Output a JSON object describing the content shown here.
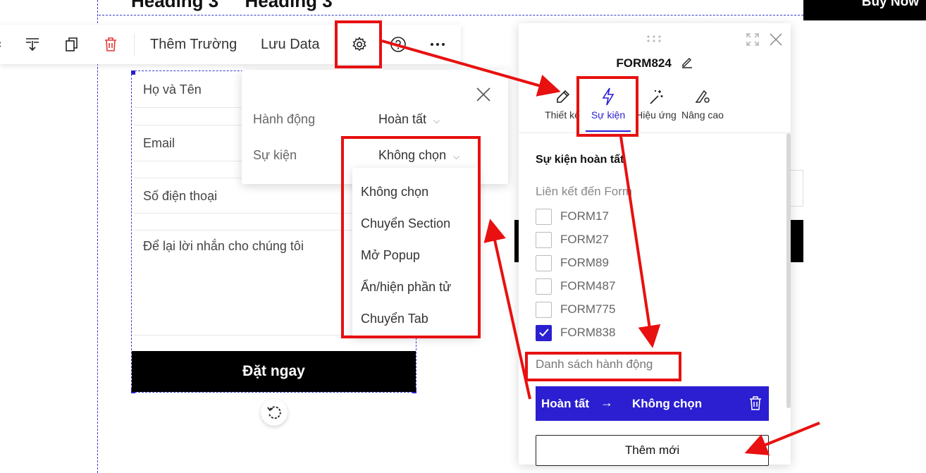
{
  "canvas": {
    "headings": [
      "Heading 3",
      "Heading 3"
    ],
    "buy_now": "Buy Now"
  },
  "toolbar": {
    "add_field": "Thêm Trường",
    "save_data": "Lưu Data",
    "icons": [
      "move-down-icon",
      "duplicate-icon",
      "trash-icon",
      "gear-icon",
      "help-icon",
      "more-icon"
    ]
  },
  "form": {
    "fields": [
      "Họ và Tên",
      "Email",
      "Số điện thoại",
      "Để lại lời nhắn cho chúng tôi"
    ],
    "submit_label": "Đặt ngay"
  },
  "settings_popover": {
    "action_label": "Hành động",
    "action_value": "Hoàn tất",
    "event_label": "Sự kiện",
    "event_value": "Không chọn"
  },
  "event_dropdown": {
    "options": [
      "Không chọn",
      "Chuyển Section",
      "Mở Popup",
      "Ẩn/hiện phần tử",
      "Chuyển Tab"
    ]
  },
  "panel": {
    "title": "FORM824",
    "tabs": [
      {
        "label": "Thiết kế",
        "icon": "pencil-icon"
      },
      {
        "label": "Sự kiện",
        "icon": "lightning-icon",
        "active": true
      },
      {
        "label": "Hiệu ứng",
        "icon": "magic-wand-icon"
      },
      {
        "label": "Nâng cao",
        "icon": "advanced-settings-icon"
      }
    ],
    "section_title": "Sự kiện hoàn tất",
    "link_label": "Liên kết đến Form",
    "forms": [
      {
        "name": "FORM17",
        "checked": false
      },
      {
        "name": "FORM27",
        "checked": false
      },
      {
        "name": "FORM89",
        "checked": false
      },
      {
        "name": "FORM487",
        "checked": false
      },
      {
        "name": "FORM775",
        "checked": false
      },
      {
        "name": "FORM838",
        "checked": true
      }
    ],
    "action_list_label": "Danh sách hành động",
    "action_item": {
      "from": "Hoàn tất",
      "to": "Không chọn"
    },
    "add_new": "Thêm mới"
  },
  "colors": {
    "accent": "#2b1fd1",
    "annotation": "#e81010",
    "delete": "#e53935"
  }
}
